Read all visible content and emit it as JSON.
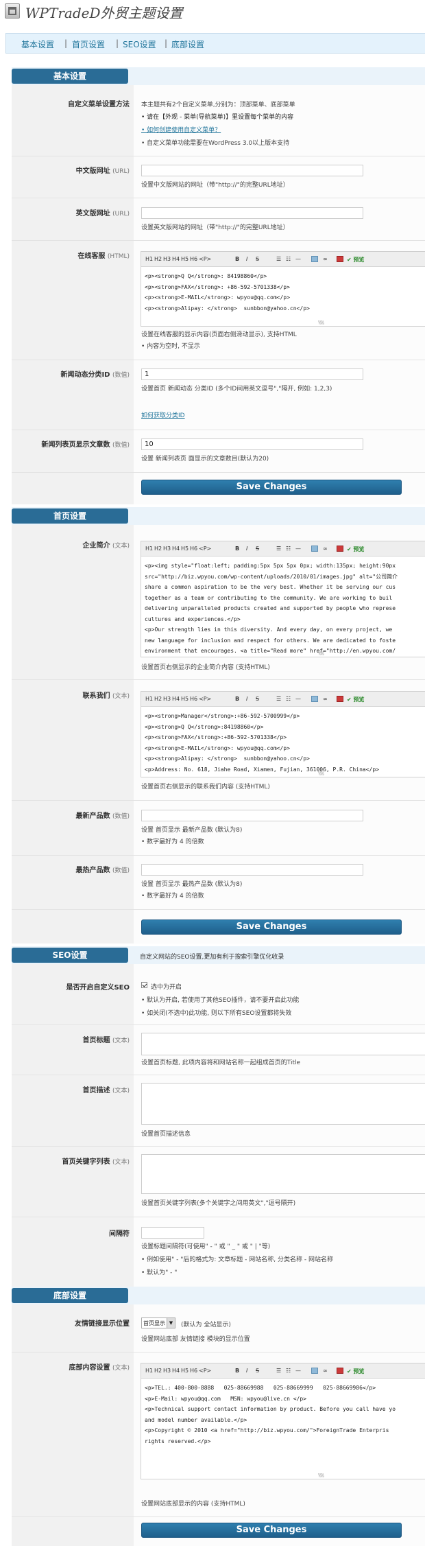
{
  "header": {
    "title": "WPTradeD外贸主题设置"
  },
  "nav": {
    "items": [
      "基本设置",
      "首页设置",
      "SEO设置",
      "底部设置"
    ]
  },
  "basic": {
    "section_title": "基本设置",
    "menu": {
      "label": "自定义菜单设置方法",
      "lines": [
        "本主题共有2个自定义菜单,分别为：顶部菜单、底部菜单",
        "• 请在【外观 - 菜单(导航菜单)】里设置每个菜单的内容",
        "• 如何创建使用自定义菜单？",
        "• 自定义菜单功能需要在WordPress 3.0以上版本支持"
      ]
    },
    "cn_site": {
      "label": "中文版网址",
      "hint": "(URL)",
      "value": "",
      "help": "设置中文版网站的网址（带\"http://\"的完整URL地址）"
    },
    "en_site": {
      "label": "英文版网址",
      "hint": "(URL)",
      "value": "",
      "help": "设置英文版网站的网址（带\"http://\"的完整URL地址）"
    },
    "service": {
      "label": "在线客服",
      "hint": "(HTML)",
      "code": [
        "<p><strong>Q Q</strong>: 84198860</p>",
        "<p><strong>FAX</strong>: +86-592-5701338</p>",
        "<p><strong>E-MAIL</strong>: wpyou@qq.com</p>",
        "<p><strong>Alipay: </strong>  sunbbon@yahoo.cn</p>"
      ],
      "help": [
        "设置在线客服的显示内容(页面右侧滑动显示), 支持HTML",
        "• 内容为空时, 不显示"
      ]
    },
    "news_cat": {
      "label": "新闻动态分类ID",
      "hint": "(数值)",
      "value": "1",
      "help": "设置首页 新闻动态 分类ID (多个ID间用英文逗号\",\"隔开, 例如: 1,2,3)",
      "link": "如何获取分类ID"
    },
    "news_count": {
      "label": "新闻列表页显示文章数",
      "hint": "(数值)",
      "value": "10",
      "help": "设置 新闻列表页 面显示的文章数目(默认为20)"
    },
    "save": "Save Changes"
  },
  "home": {
    "section_title": "首页设置",
    "intro": {
      "label": "企业简介",
      "hint": "(文本)",
      "code": [
        "<p><img style=\"float:left; padding:5px 5px 5px 0px; width:135px; height:90px",
        "src=\"http://biz.wpyou.com/wp-content/uploads/2010/01/images.jpg\" alt=\"公司简介",
        "share a common aspiration to be the very best. Whether it be serving our cus",
        "together as a team or contributing to the community. We are working to buil",
        "delivering unparalleled products created and supported by people who represe",
        "cultures and experiences.</p>",
        "<p>Our strength lies in this diversity. And every day, on every project, we",
        "new language for inclusion and respect for others. We are dedicated to foste",
        "environment that encourages. <a title=\"Read more\" href=\"http://en.wpyou.com/"
      ],
      "help": "设置首页右侧显示的企业简介内容 (支持HTML)"
    },
    "contact": {
      "label": "联系我们",
      "hint": "(文本)",
      "code": [
        "<p><strong>Manager</strong>:+86-592-5700999</p>",
        "<p><strong>Q Q</strong>:84198860</p>",
        "<p><strong>FAX</strong>:+86-592-5701338</p>",
        "<p><strong>E-MAIL</strong>: wpyou@qq.com</p>",
        "<p><strong>Alipay: </strong>  sunbbon@yahoo.cn</p>",
        "<p>Address: No. 618, Jiahe Road, Xiamen, Fujian, 361006, P.R. China</p>"
      ],
      "help": "设置首页右侧显示的联系我们内容 (支持HTML)"
    },
    "new_products": {
      "label": "最新产品数",
      "hint": "(数值)",
      "value": "",
      "help": [
        "设置 首页显示 最新产品数 (默认为8)",
        "• 数字最好为 4 的倍数"
      ]
    },
    "hot_products": {
      "label": "最热产品数",
      "hint": "(数值)",
      "value": "",
      "help": [
        "设置 首页显示 最热产品数 (默认为8)",
        "• 数字最好为 4 的倍数"
      ]
    },
    "save": "Save Changes"
  },
  "seo": {
    "section_title": "SEO设置",
    "section_desc": "自定义网站的SEO设置,更加有利于搜索引擎优化收录",
    "enable": {
      "label": "是否开启自定义SEO",
      "checkbox_label": "选中为开启",
      "help": [
        "• 默认为开启, 若使用了其他SEO插件，请不要开启此功能",
        "• 如关闭(不选中)此功能, 则以下所有SEO设置都将失效"
      ]
    },
    "home_title": {
      "label": "首页标题",
      "hint": "(文本)",
      "help": "设置首页标题, 此项内容将和网站名称一起组成首页的Title"
    },
    "home_desc": {
      "label": "首页描述",
      "hint": "(文本)",
      "help": "设置首页描述信息"
    },
    "home_keywords": {
      "label": "首页关键字列表",
      "hint": "(文本)",
      "help": "设置首页关键字列表(多个关键字之间用英文\",\"逗号隔开)"
    },
    "separator": {
      "label": "间隔符",
      "help": [
        "设置标题间隔符(可使用\" - \" 或 \" _ \" 或 \" | \"等)",
        "• 例如使用\" - \"后的格式为: 文章标题 - 网站名称, 分类名称 - 网站名称",
        "• 默认为\" - \""
      ]
    }
  },
  "footer": {
    "section_title": "底部设置",
    "links": {
      "label": "友情链接显示位置",
      "select_value": "首页显示",
      "note": "(默认为 全站显示)",
      "help": "设置网站底部 友情链接 模块的显示位置"
    },
    "content": {
      "label": "底部内容设置",
      "hint": "(文本)",
      "code": [
        "<p>TEL.: 400-800-8888   025-88669988   025-88669999   025-88669986</p>",
        "<p>E-Mail: wpyou@qq.com   MSN: wpyou@live.cn </p>",
        "<p>Technical support contact information by product. Before you call have yo",
        "and model number available.</p>",
        "<p>Copyright © 2010 <a href=\"http://biz.wpyou.com/\">ForeignTrade Enterpris",
        "rights reserved.</p>"
      ],
      "help": "设置网站底部显示的内容 (支持HTML)"
    },
    "save": "Save Changes"
  },
  "editor_toolbar": {
    "headings": [
      "H1",
      "H2",
      "H3",
      "H4",
      "H5",
      "H6",
      "<P>"
    ],
    "bold": "B",
    "italic": "I",
    "strike": "S",
    "preview": "预览"
  }
}
